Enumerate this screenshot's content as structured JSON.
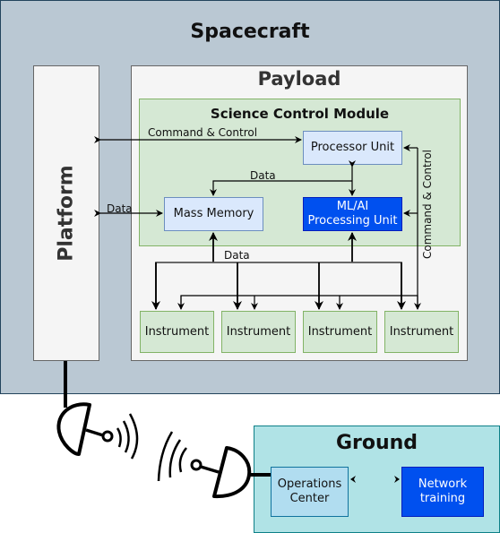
{
  "spacecraft": {
    "title": "Spacecraft"
  },
  "platform": {
    "label": "Platform"
  },
  "payload": {
    "title": "Payload",
    "science_control_module": {
      "title": "Science Control Module",
      "processor_unit": "Processor Unit",
      "mass_memory": "Mass Memory",
      "ml_ai_unit": {
        "line1": "ML/AI",
        "line2": "Processing Unit"
      }
    },
    "instruments": [
      "Instrument",
      "Instrument",
      "Instrument",
      "Instrument"
    ]
  },
  "connections": {
    "platform_command": "Command & Control",
    "platform_data": "Data",
    "processor_memory_data": "Data",
    "instruments_data": "Data",
    "instruments_command": "Command & Control"
  },
  "ground": {
    "title": "Ground",
    "operations_center": {
      "line1": "Operations",
      "line2": "Center"
    },
    "network_training": {
      "line1": "Network",
      "line2": "training"
    }
  },
  "colors": {
    "spacecraft_fill": "#bac8d3",
    "spacecraft_border": "#23445d",
    "module_fill": "#d5e8d4",
    "module_border": "#82b366",
    "unit_fill": "#dae8fc",
    "accent_blue": "#0050ef",
    "ground_fill": "#b0e3e6",
    "ops_fill": "#b1ddf0"
  },
  "icons": [
    "antenna-dish-icon",
    "radio-waves-icon"
  ]
}
